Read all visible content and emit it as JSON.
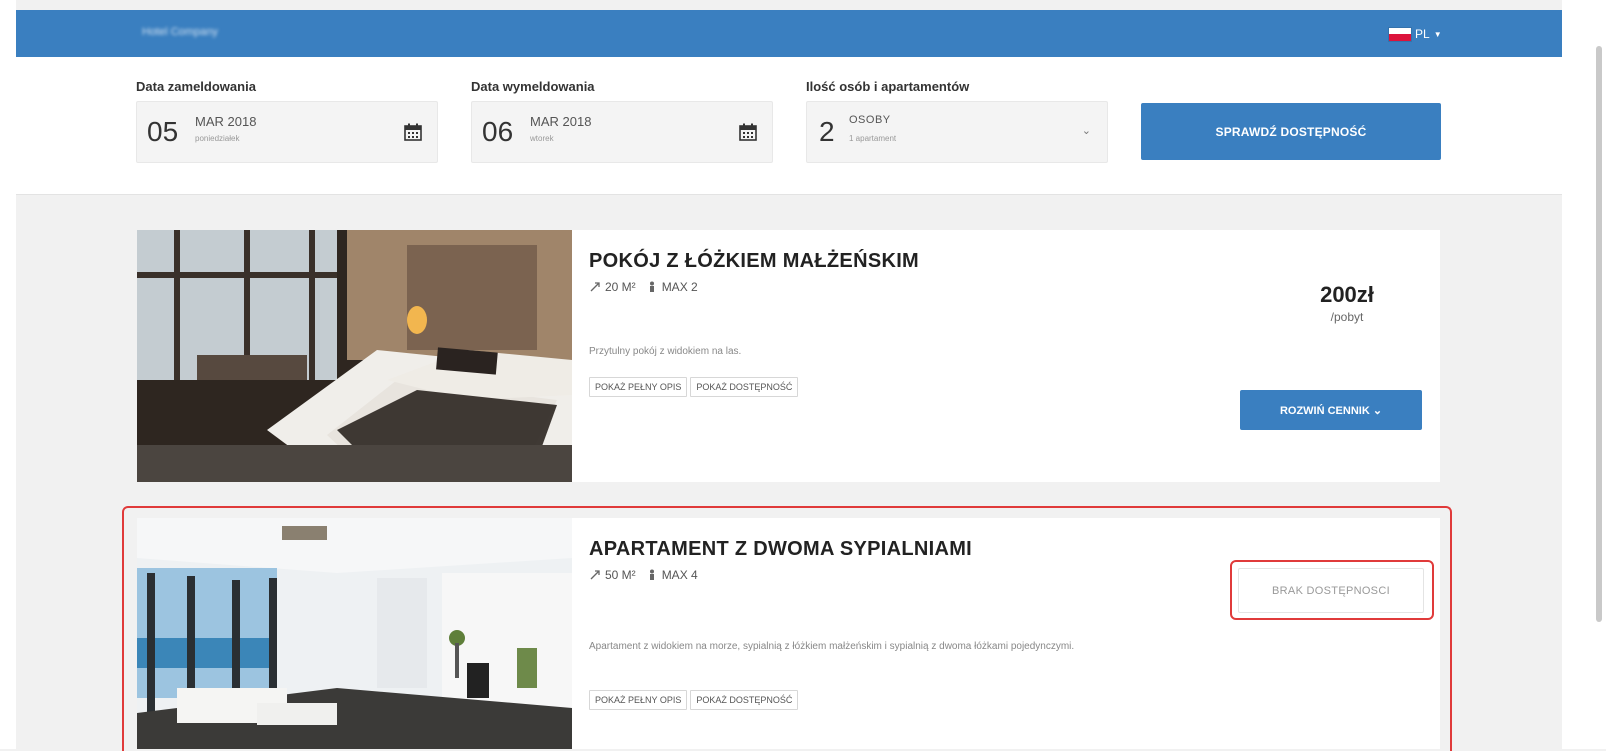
{
  "header": {
    "brand": "Hotel Company",
    "language": "PL",
    "colors": {
      "primary": "#3a7fc0",
      "highlight": "#e03a3a"
    }
  },
  "search": {
    "checkin": {
      "label": "Data zameldowania",
      "day": "05",
      "month": "MAR 2018",
      "weekday": "poniedziałek",
      "icon": "calendar-icon"
    },
    "checkout": {
      "label": "Data wymeldowania",
      "day": "06",
      "month": "MAR 2018",
      "weekday": "wtorek",
      "icon": "calendar-icon"
    },
    "guests": {
      "label": "Ilość osób i apartamentów",
      "count": "2",
      "unit": "OSOBY",
      "rooms": "1 apartament",
      "icon": "chevron-down-icon"
    },
    "submit_label": "SPRAWDŹ DOSTĘPNOŚĆ"
  },
  "rooms": [
    {
      "title": "POKÓJ Z ŁÓŻKIEM MAŁŻEŃSKIM",
      "area": "20 M²",
      "capacity": "MAX 2",
      "description": "Przytulny pokój z widokiem na las.",
      "link_description": "POKAŻ PEŁNY OPIS",
      "link_availability": "POKAŻ DOSTĘPNOŚĆ",
      "price": "200zł",
      "price_unit": "/pobyt",
      "action_label": "ROZWIŃ CENNIK ⌄"
    },
    {
      "title": "APARTAMENT Z DWOMA SYPIALNIAMI",
      "area": "50 M²",
      "capacity": "MAX 4",
      "description": "Apartament z widokiem na morze, sypialnią z łóżkiem małżeńskim i sypialnią z dwoma łóżkami pojedynczymi.",
      "link_description": "POKAŻ PEŁNY OPIS",
      "link_availability": "POKAŻ DOSTĘPNOŚĆ",
      "status_label": "BRAK DOSTĘPNOSCI"
    }
  ]
}
